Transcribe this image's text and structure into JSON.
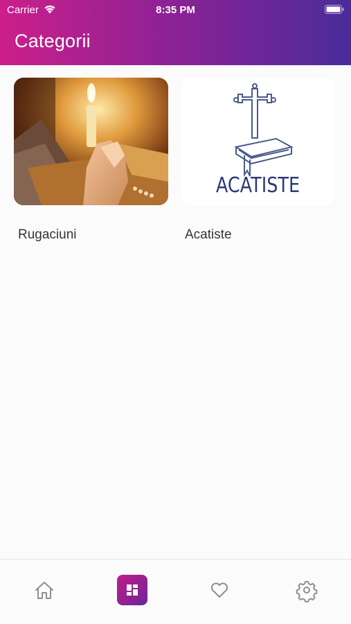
{
  "status_bar": {
    "carrier": "Carrier",
    "time": "8:35 PM"
  },
  "header": {
    "title": "Categorii",
    "gradient": [
      "#cc1f8a",
      "#4a2c9a"
    ]
  },
  "categories": [
    {
      "label": "Rugaciuni",
      "image": "praying-candle-photo"
    },
    {
      "label": "Acatiste",
      "image": "acatiste-cross-book-logo",
      "image_text": "ACATISTE"
    }
  ],
  "bottom_nav": {
    "items": [
      {
        "icon": "home-icon",
        "active": false
      },
      {
        "icon": "categories-icon",
        "active": true
      },
      {
        "icon": "heart-icon",
        "active": false
      },
      {
        "icon": "gear-icon",
        "active": false
      }
    ],
    "active_color": "#a3218f",
    "inactive_color": "#8e8e93"
  }
}
